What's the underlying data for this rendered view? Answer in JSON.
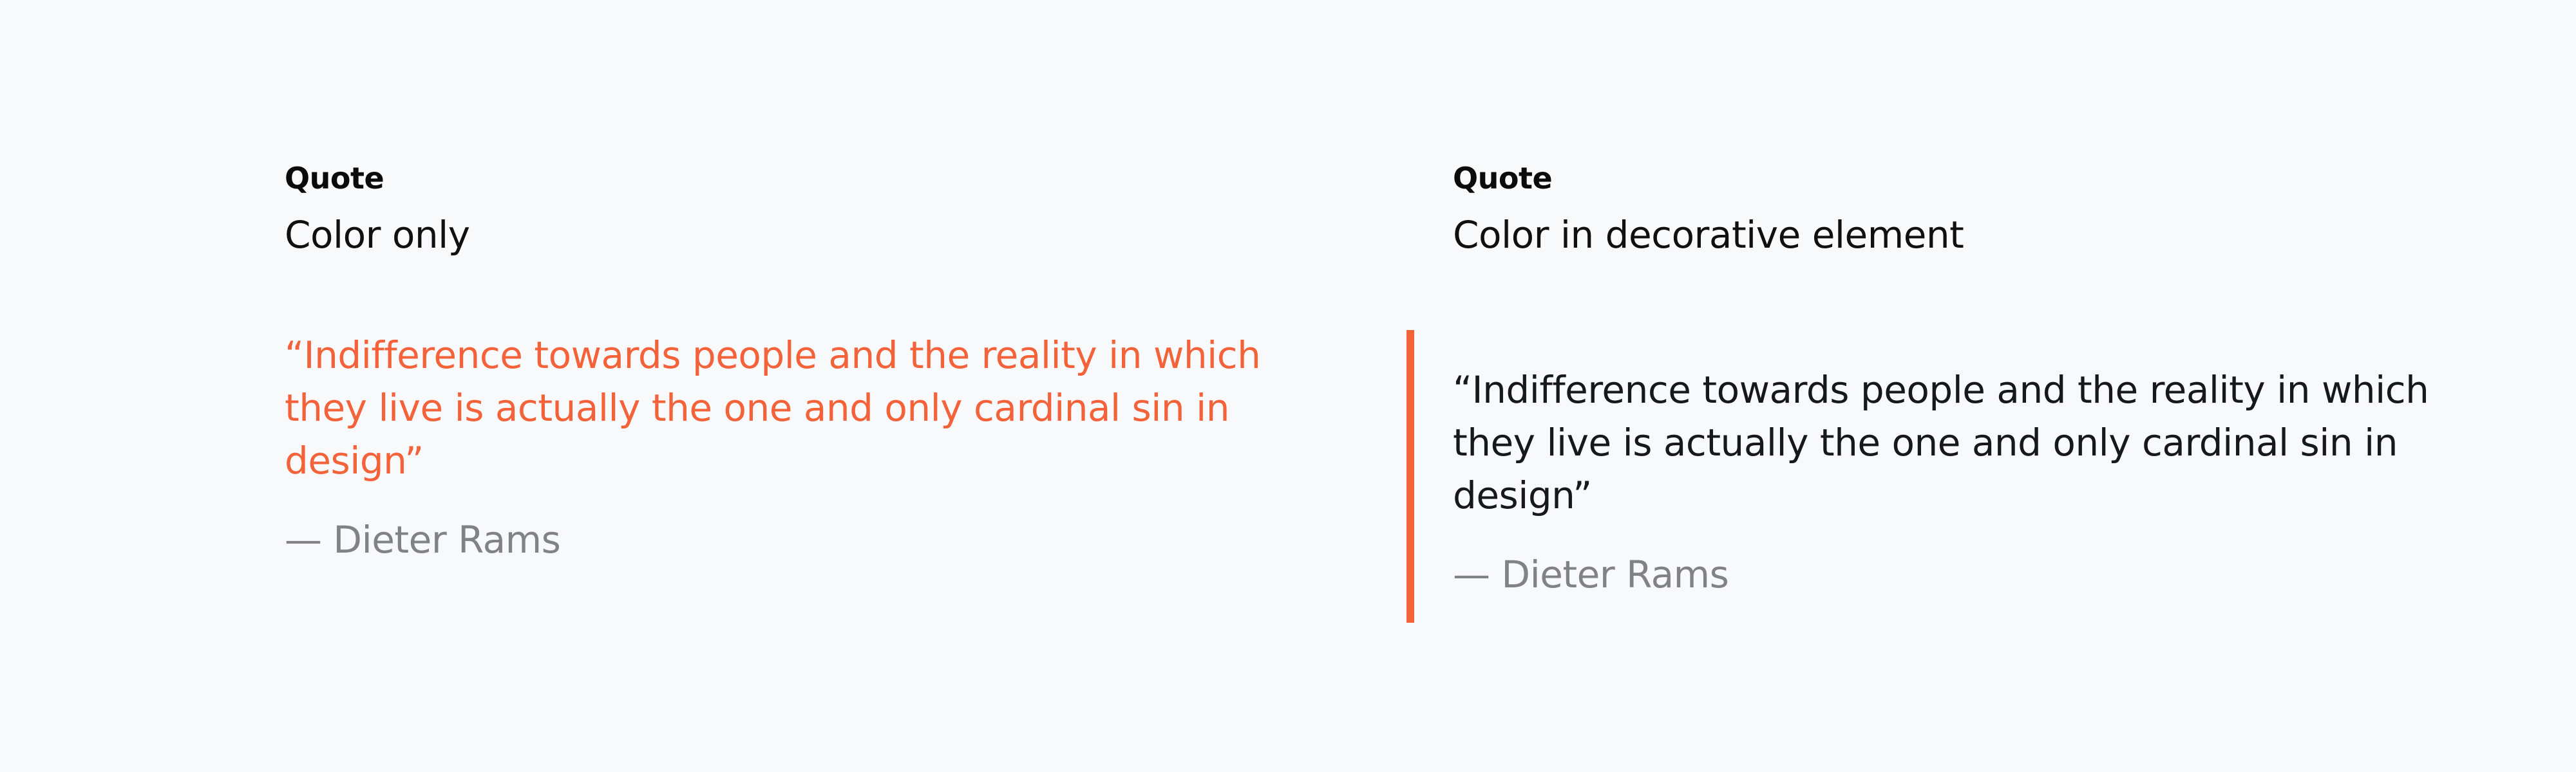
{
  "examples": [
    {
      "eyebrow": "Quote",
      "title": "Color only",
      "quote": "“Indifference towards people and the reality in which they live is actually the one and only cardinal sin in design”",
      "attribution": "— Dieter Rams"
    },
    {
      "eyebrow": "Quote",
      "title": "Color in decorative element",
      "quote": "“Indifference towards people and the reality in which they live is actually the one and only cardinal sin in design”",
      "attribution": "— Dieter Rams"
    }
  ],
  "colors": {
    "accent": "#f4623a",
    "text": "#16181d",
    "muted": "#808287",
    "background": "#f8f9fb"
  }
}
